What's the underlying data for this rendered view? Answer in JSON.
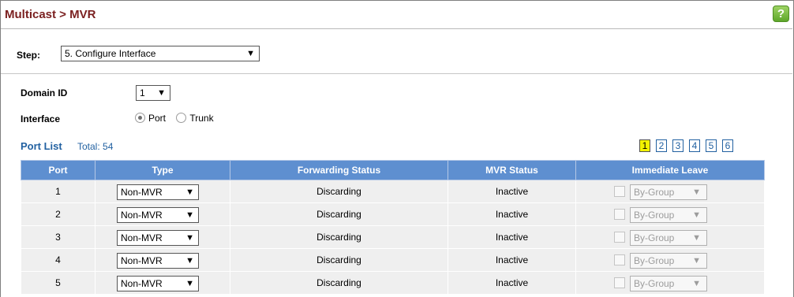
{
  "header": {
    "title": "Multicast > MVR",
    "help_icon": "?"
  },
  "step": {
    "label": "Step:",
    "selected": "5. Configure Interface"
  },
  "form": {
    "domain_label": "Domain ID",
    "domain_value": "1",
    "interface_label": "Interface",
    "interface_options": [
      "Port",
      "Trunk"
    ],
    "interface_selected": "Port"
  },
  "port_list": {
    "title": "Port List",
    "total": "Total: 54",
    "pages": [
      "1",
      "2",
      "3",
      "4",
      "5",
      "6"
    ],
    "active_page": "1",
    "columns": [
      "Port",
      "Type",
      "Forwarding Status",
      "MVR Status",
      "Immediate Leave"
    ],
    "rows": [
      {
        "port": "1",
        "type": "Non-MVR",
        "forwarding": "Discarding",
        "mvr_status": "Inactive",
        "leave": "By-Group"
      },
      {
        "port": "2",
        "type": "Non-MVR",
        "forwarding": "Discarding",
        "mvr_status": "Inactive",
        "leave": "By-Group"
      },
      {
        "port": "3",
        "type": "Non-MVR",
        "forwarding": "Discarding",
        "mvr_status": "Inactive",
        "leave": "By-Group"
      },
      {
        "port": "4",
        "type": "Non-MVR",
        "forwarding": "Discarding",
        "mvr_status": "Inactive",
        "leave": "By-Group"
      },
      {
        "port": "5",
        "type": "Non-MVR",
        "forwarding": "Discarding",
        "mvr_status": "Inactive",
        "leave": "By-Group"
      }
    ]
  },
  "colors": {
    "title": "#7a1f1f",
    "header_bg": "#5e8fd0",
    "link": "#2261a1",
    "active_page": "#f3f300",
    "help": "#6bb32e"
  }
}
